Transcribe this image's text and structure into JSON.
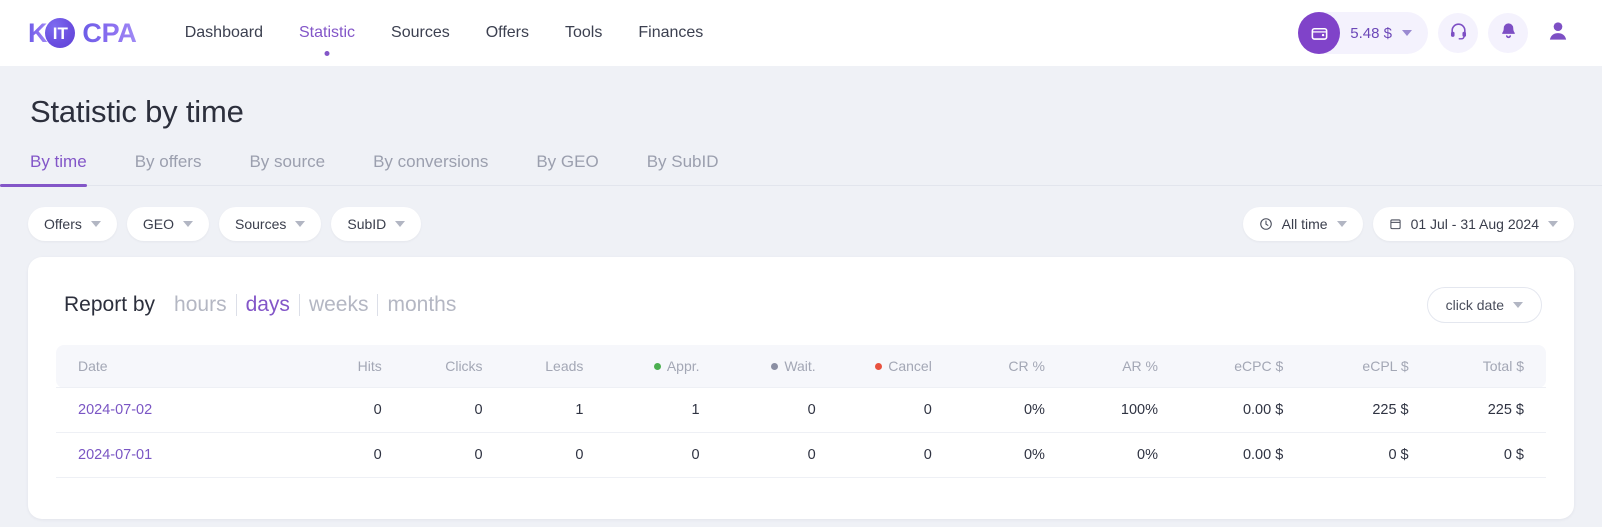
{
  "brand": {
    "part1": "K",
    "badge": "IT",
    "part2": "CPA"
  },
  "nav": {
    "items": [
      {
        "label": "Dashboard",
        "active": false
      },
      {
        "label": "Statistic",
        "active": true
      },
      {
        "label": "Sources",
        "active": false
      },
      {
        "label": "Offers",
        "active": false
      },
      {
        "label": "Tools",
        "active": false
      },
      {
        "label": "Finances",
        "active": false
      }
    ]
  },
  "account": {
    "balance": "5.48 $",
    "wallet_icon": "wallet-icon",
    "caret_icon": "chevron-down-icon",
    "support_icon": "headset-icon",
    "notifications_icon": "bell-icon",
    "avatar_icon": "user-avatar-icon"
  },
  "page": {
    "title": "Statistic by time"
  },
  "tabs": [
    {
      "label": "By time",
      "active": true
    },
    {
      "label": "By offers",
      "active": false
    },
    {
      "label": "By source",
      "active": false
    },
    {
      "label": "By conversions",
      "active": false
    },
    {
      "label": "By GEO",
      "active": false
    },
    {
      "label": "By SubID",
      "active": false
    }
  ],
  "filters": {
    "left": [
      {
        "label": "Offers"
      },
      {
        "label": "GEO"
      },
      {
        "label": "Sources"
      },
      {
        "label": "SubID"
      }
    ],
    "right": [
      {
        "label": "All time",
        "icon": "clock-icon"
      },
      {
        "label": "01 Jul - 31 Aug 2024",
        "icon": "calendar-icon"
      }
    ]
  },
  "report": {
    "label": "Report by",
    "granularity": [
      {
        "label": "hours",
        "active": false
      },
      {
        "label": "days",
        "active": true
      },
      {
        "label": "weeks",
        "active": false
      },
      {
        "label": "months",
        "active": false
      }
    ],
    "click_date": "click date"
  },
  "table": {
    "columns": [
      {
        "key": "date",
        "label": "Date",
        "dot": null
      },
      {
        "key": "hits",
        "label": "Hits",
        "dot": null
      },
      {
        "key": "clicks",
        "label": "Clicks",
        "dot": null
      },
      {
        "key": "leads",
        "label": "Leads",
        "dot": null
      },
      {
        "key": "appr",
        "label": "Appr.",
        "dot": "#4caf50"
      },
      {
        "key": "wait",
        "label": "Wait.",
        "dot": "#8b8fa3"
      },
      {
        "key": "cancel",
        "label": "Cancel",
        "dot": "#e8523f"
      },
      {
        "key": "cr",
        "label": "CR %",
        "dot": null
      },
      {
        "key": "ar",
        "label": "AR %",
        "dot": null
      },
      {
        "key": "ecpc",
        "label": "eCPC $",
        "dot": null
      },
      {
        "key": "ecpl",
        "label": "eCPL $",
        "dot": null
      },
      {
        "key": "total",
        "label": "Total $",
        "dot": null
      }
    ],
    "rows": [
      {
        "date": "2024-07-02",
        "hits": "0",
        "clicks": "0",
        "leads": "1",
        "appr": "1",
        "wait": "0",
        "cancel": "0",
        "cr": "0%",
        "ar": "100%",
        "ecpc": "0.00 $",
        "ecpl": "225 $",
        "total": "225 $"
      },
      {
        "date": "2024-07-01",
        "hits": "0",
        "clicks": "0",
        "leads": "0",
        "appr": "0",
        "wait": "0",
        "cancel": "0",
        "cr": "0%",
        "ar": "0%",
        "ecpc": "0.00 $",
        "ecpl": "0 $",
        "total": "0 $"
      }
    ]
  },
  "colors": {
    "accent": "#8356c8",
    "brand_purple": "#6c5ce7",
    "wallet_bg": "#8043c9",
    "page_bg": "#eff1f6",
    "header_row_bg": "#f6f7fb",
    "status_appr": "#4caf50",
    "status_wait": "#8b8fa3",
    "status_cancel": "#e8523f"
  }
}
